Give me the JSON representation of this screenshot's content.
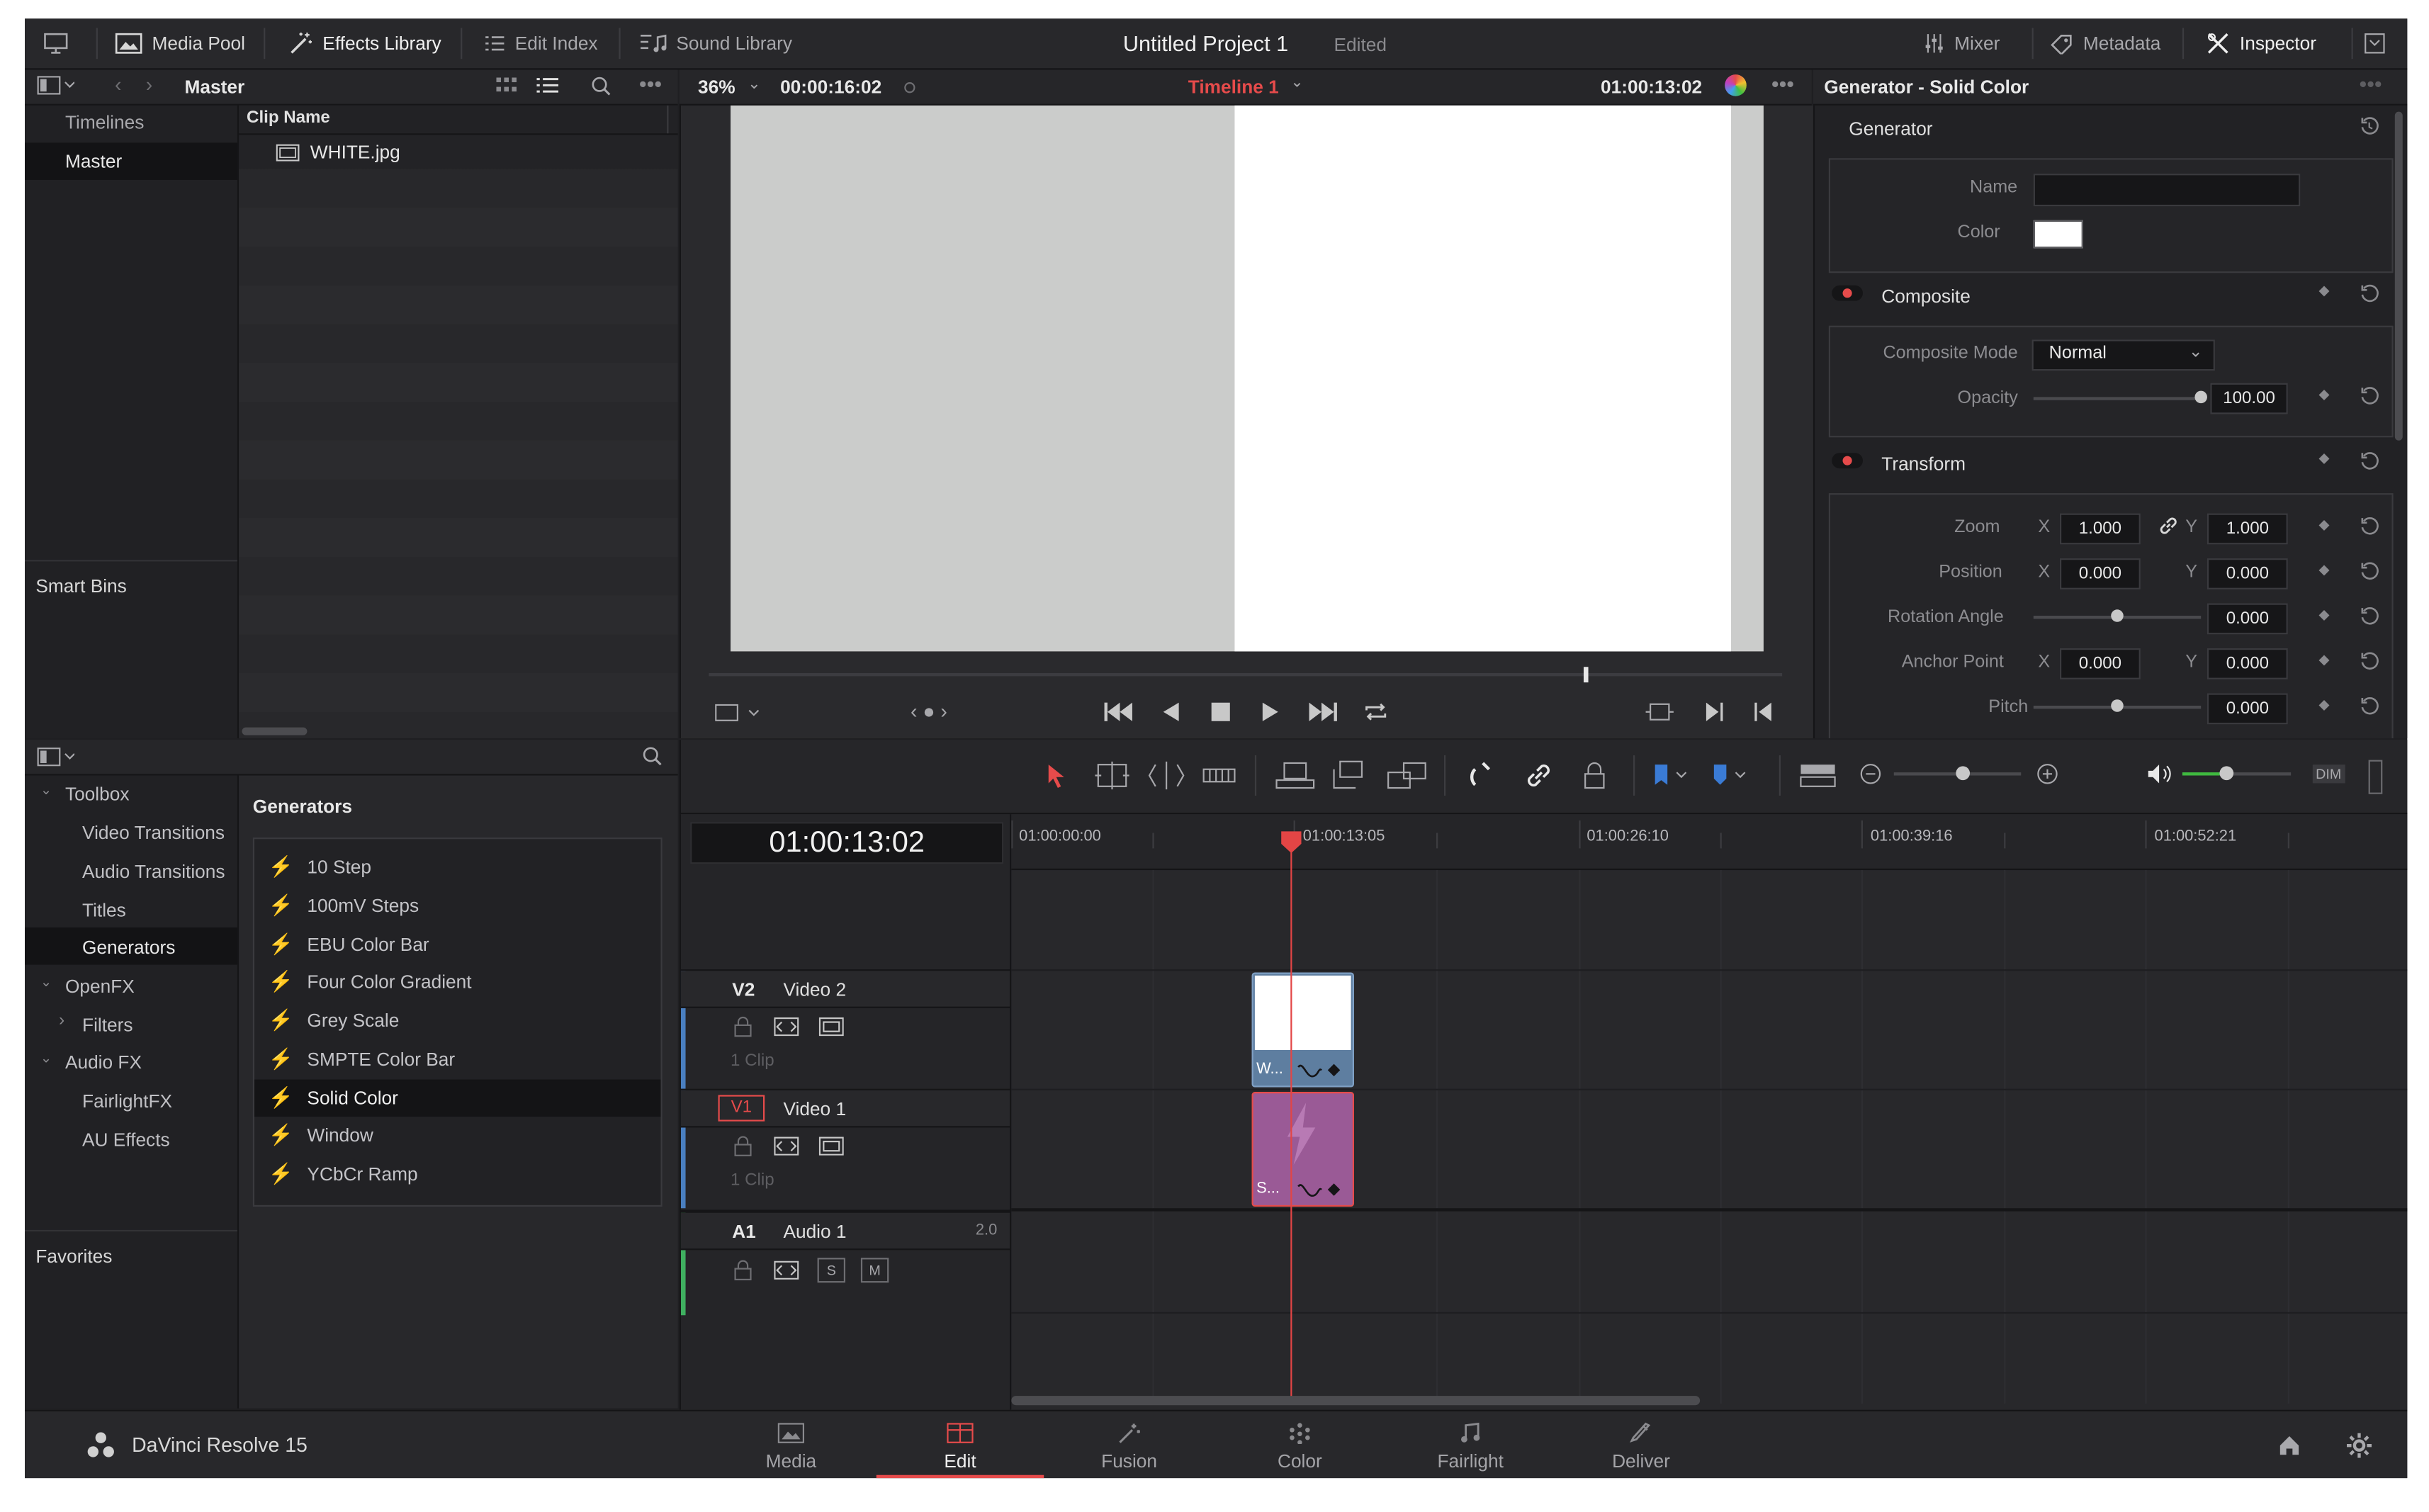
{
  "project": {
    "title": "Untitled Project 1",
    "status": "Edited"
  },
  "topbar": {
    "media_pool": "Media Pool",
    "effects_library": "Effects Library",
    "edit_index": "Edit Index",
    "sound_library": "Sound Library",
    "mixer": "Mixer",
    "metadata": "Metadata",
    "inspector": "Inspector"
  },
  "media_pool": {
    "bin_title": "Master",
    "bins": [
      "Timelines",
      "Master"
    ],
    "smart_bins": "Smart Bins",
    "column_header": "Clip Name",
    "clips": [
      "WHITE.jpg"
    ]
  },
  "viewer": {
    "zoom": "36%",
    "source_timecode": "00:00:16:02",
    "timeline_name": "Timeline 1",
    "record_timecode": "01:00:13:02"
  },
  "inspector": {
    "title": "Generator - Solid Color",
    "generator": {
      "section": "Generator",
      "name_label": "Name",
      "name_value": "",
      "color_label": "Color",
      "color_value": "#ffffff"
    },
    "composite": {
      "section": "Composite",
      "mode_label": "Composite Mode",
      "mode_value": "Normal",
      "opacity_label": "Opacity",
      "opacity_value": "100.00",
      "opacity_level": 1.0
    },
    "transform": {
      "section": "Transform",
      "zoom_label": "Zoom",
      "zoom_x": "1.000",
      "zoom_y": "1.000",
      "position_label": "Position",
      "position_x": "0.000",
      "position_y": "0.000",
      "rotation_label": "Rotation Angle",
      "rotation_value": "0.000",
      "rotation_level": 0.5,
      "anchor_label": "Anchor Point",
      "anchor_x": "0.000",
      "anchor_y": "0.000",
      "pitch_label": "Pitch",
      "pitch_value": "0.000",
      "pitch_level": 0.5,
      "x": "X",
      "y": "Y"
    }
  },
  "effects": {
    "tree": {
      "toolbox": "Toolbox",
      "video_transitions": "Video Transitions",
      "audio_transitions": "Audio Transitions",
      "titles": "Titles",
      "generators": "Generators",
      "openfx": "OpenFX",
      "filters": "Filters",
      "audio_fx": "Audio FX",
      "fairlight_fx": "FairlightFX",
      "au_effects": "AU Effects"
    },
    "favorites": "Favorites",
    "list_title": "Generators",
    "items": [
      "10 Step",
      "100mV Steps",
      "EBU Color Bar",
      "Four Color Gradient",
      "Grey Scale",
      "SMPTE Color Bar",
      "Solid Color",
      "Window",
      "YCbCr Ramp"
    ],
    "selected": "Solid Color"
  },
  "timeline": {
    "timecode": "01:00:13:02",
    "ruler": [
      "01:00:00:00",
      "01:00:13:05",
      "01:00:26:10",
      "01:00:39:16",
      "01:00:52:21"
    ],
    "tracks": {
      "v2": {
        "id": "V2",
        "name": "Video 2",
        "clips": "1 Clip",
        "clip_label": "W..."
      },
      "v1": {
        "id": "V1",
        "name": "Video 1",
        "clips": "1 Clip",
        "clip_label": "S..."
      },
      "a1": {
        "id": "A1",
        "name": "Audio 1",
        "channels": "2.0",
        "solo": "S",
        "mute": "M"
      }
    },
    "dim": "DIM"
  },
  "pages": {
    "brand": "DaVinci Resolve 15",
    "tabs": [
      "Media",
      "Edit",
      "Fusion",
      "Color",
      "Fairlight",
      "Deliver"
    ],
    "active": "Edit"
  },
  "colors": {
    "accent_red": "#e64b4b",
    "clip_v2": "#5e7ea0",
    "clip_v1": "#9a5a96",
    "playhead": "#e34545"
  }
}
